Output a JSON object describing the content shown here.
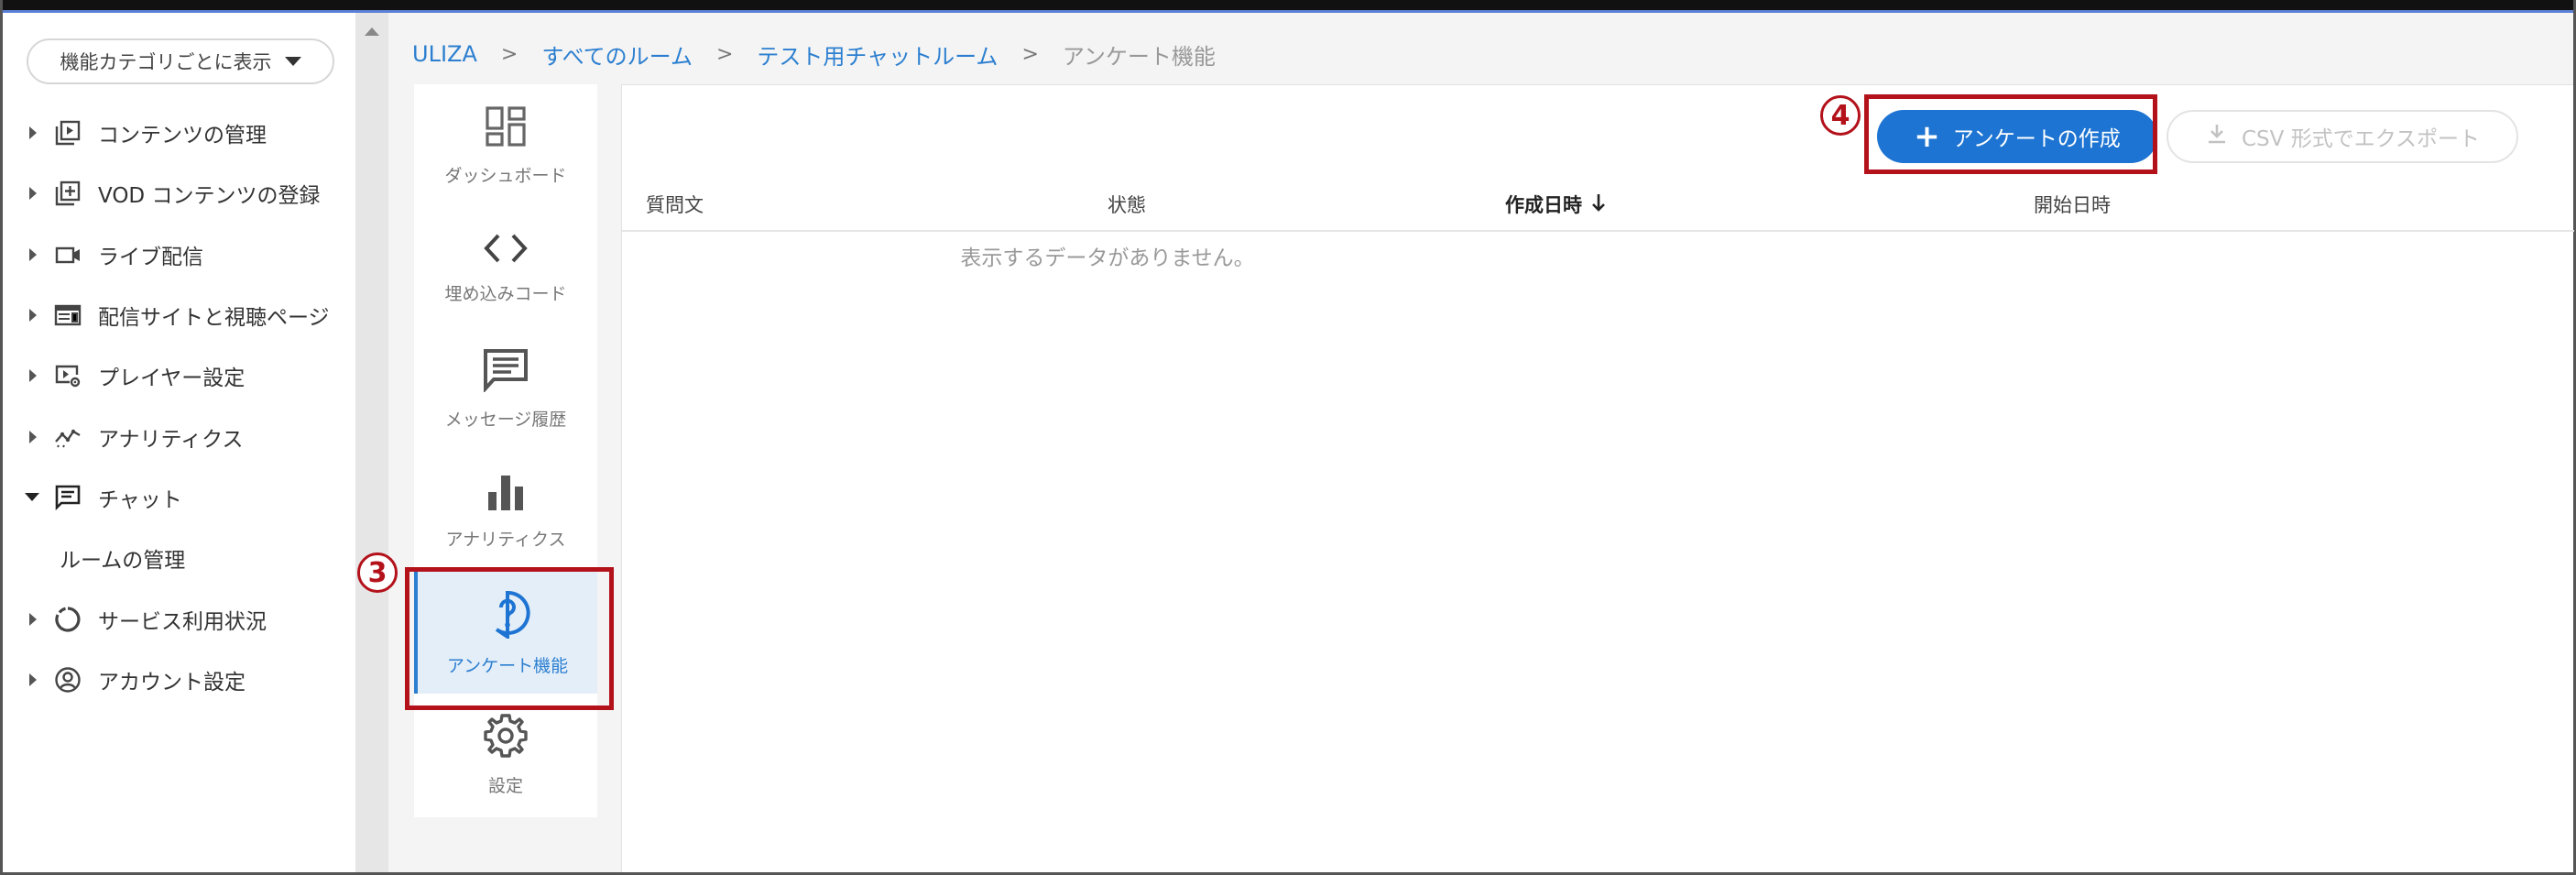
{
  "sidebar": {
    "filter_label": "機能カテゴリごとに表示",
    "items": [
      {
        "label": "コンテンツの管理",
        "icon": "play-library-icon",
        "expanded": false
      },
      {
        "label": "VOD コンテンツの登録",
        "icon": "add-box-icon",
        "expanded": false
      },
      {
        "label": "ライブ配信",
        "icon": "videocam-icon",
        "expanded": false
      },
      {
        "label": "配信サイトと視聴ページ",
        "icon": "web-layout-icon",
        "expanded": false
      },
      {
        "label": "プレイヤー設定",
        "icon": "player-settings-icon",
        "expanded": false
      },
      {
        "label": "アナリティクス",
        "icon": "analytics-line-icon",
        "expanded": false
      },
      {
        "label": "チャット",
        "icon": "chat-icon",
        "expanded": true
      },
      {
        "label": "ルームの管理",
        "sub": true
      },
      {
        "label": "サービス利用状況",
        "icon": "donut-icon",
        "expanded": false
      },
      {
        "label": "アカウント設定",
        "icon": "account-icon",
        "expanded": false
      }
    ]
  },
  "breadcrumb": {
    "items": [
      "ULIZA",
      "すべてのルーム",
      "テスト用チャットルーム",
      "アンケート機能"
    ],
    "separator": ">"
  },
  "subnav": {
    "items": [
      {
        "label": "ダッシュボード",
        "icon": "dashboard-icon"
      },
      {
        "label": "埋め込みコード",
        "icon": "code-icon"
      },
      {
        "label": "メッセージ履歴",
        "icon": "message-icon"
      },
      {
        "label": "アナリティクス",
        "icon": "bar-chart-icon"
      },
      {
        "label": "アンケート機能",
        "icon": "question-icon",
        "active": true
      },
      {
        "label": "設定",
        "icon": "gear-icon"
      }
    ]
  },
  "toolbar": {
    "create_label": "アンケートの作成",
    "export_label": "CSV 形式でエクスポート"
  },
  "table": {
    "columns": [
      "質問文",
      "状態",
      "作成日時",
      "開始日時"
    ],
    "sorted_column": "作成日時",
    "sort_direction": "desc",
    "empty_message": "表示するデータがありません。"
  },
  "annotations": {
    "mark3": "3",
    "mark4": "4"
  },
  "colors": {
    "accent": "#1e74d2",
    "annotation": "#b3121b"
  }
}
